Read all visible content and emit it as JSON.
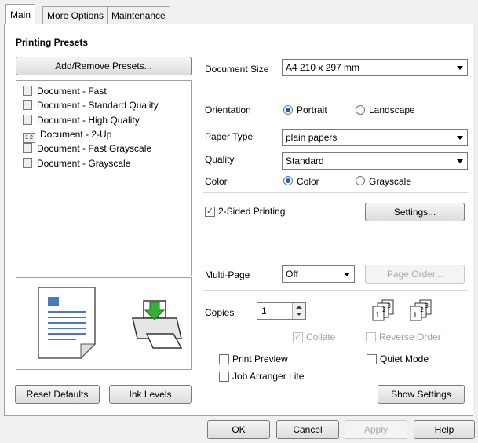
{
  "tabs": [
    {
      "label": "Main"
    },
    {
      "label": "More Options"
    },
    {
      "label": "Maintenance"
    }
  ],
  "presets": {
    "heading": "Printing Presets",
    "add_remove_label": "Add/Remove Presets...",
    "items": [
      {
        "label": "Document - Fast",
        "icon": "document-icon"
      },
      {
        "label": "Document - Standard Quality",
        "icon": "document-icon"
      },
      {
        "label": "Document - High Quality",
        "icon": "document-icon"
      },
      {
        "label": "Document - 2-Up",
        "icon": "two-up-icon",
        "glyph": "1 2"
      },
      {
        "label": "Document - Fast Grayscale",
        "icon": "document-icon"
      },
      {
        "label": "Document - Grayscale",
        "icon": "document-icon"
      }
    ]
  },
  "settings": {
    "document_size": {
      "label": "Document Size",
      "value": "A4 210 x 297 mm"
    },
    "orientation": {
      "label": "Orientation",
      "options": [
        "Portrait",
        "Landscape"
      ],
      "selected": "Portrait"
    },
    "paper_type": {
      "label": "Paper Type",
      "value": "plain papers"
    },
    "quality": {
      "label": "Quality",
      "value": "Standard"
    },
    "color": {
      "label": "Color",
      "options": [
        "Color",
        "Grayscale"
      ],
      "selected": "Color"
    },
    "two_sided": {
      "label": "2-Sided Printing",
      "checked": true,
      "settings_label": "Settings..."
    },
    "multi_page": {
      "label": "Multi-Page",
      "value": "Off",
      "page_order_label": "Page Order..."
    },
    "copies": {
      "label": "Copies",
      "value": "1",
      "collate_label": "Collate",
      "reverse_order_label": "Reverse Order"
    },
    "print_preview": {
      "label": "Print Preview",
      "checked": false
    },
    "quiet_mode": {
      "label": "Quiet Mode",
      "checked": false
    },
    "job_arranger": {
      "label": "Job Arranger Lite",
      "checked": false
    },
    "show_settings_label": "Show Settings"
  },
  "bottom_left": {
    "reset_defaults_label": "Reset Defaults",
    "ink_levels_label": "Ink Levels"
  },
  "dialog_buttons": {
    "ok": "OK",
    "cancel": "Cancel",
    "apply": "Apply",
    "help": "Help"
  },
  "colors": {
    "accent": "#1d5fbf",
    "disabled_text": "#a0a0a0"
  }
}
